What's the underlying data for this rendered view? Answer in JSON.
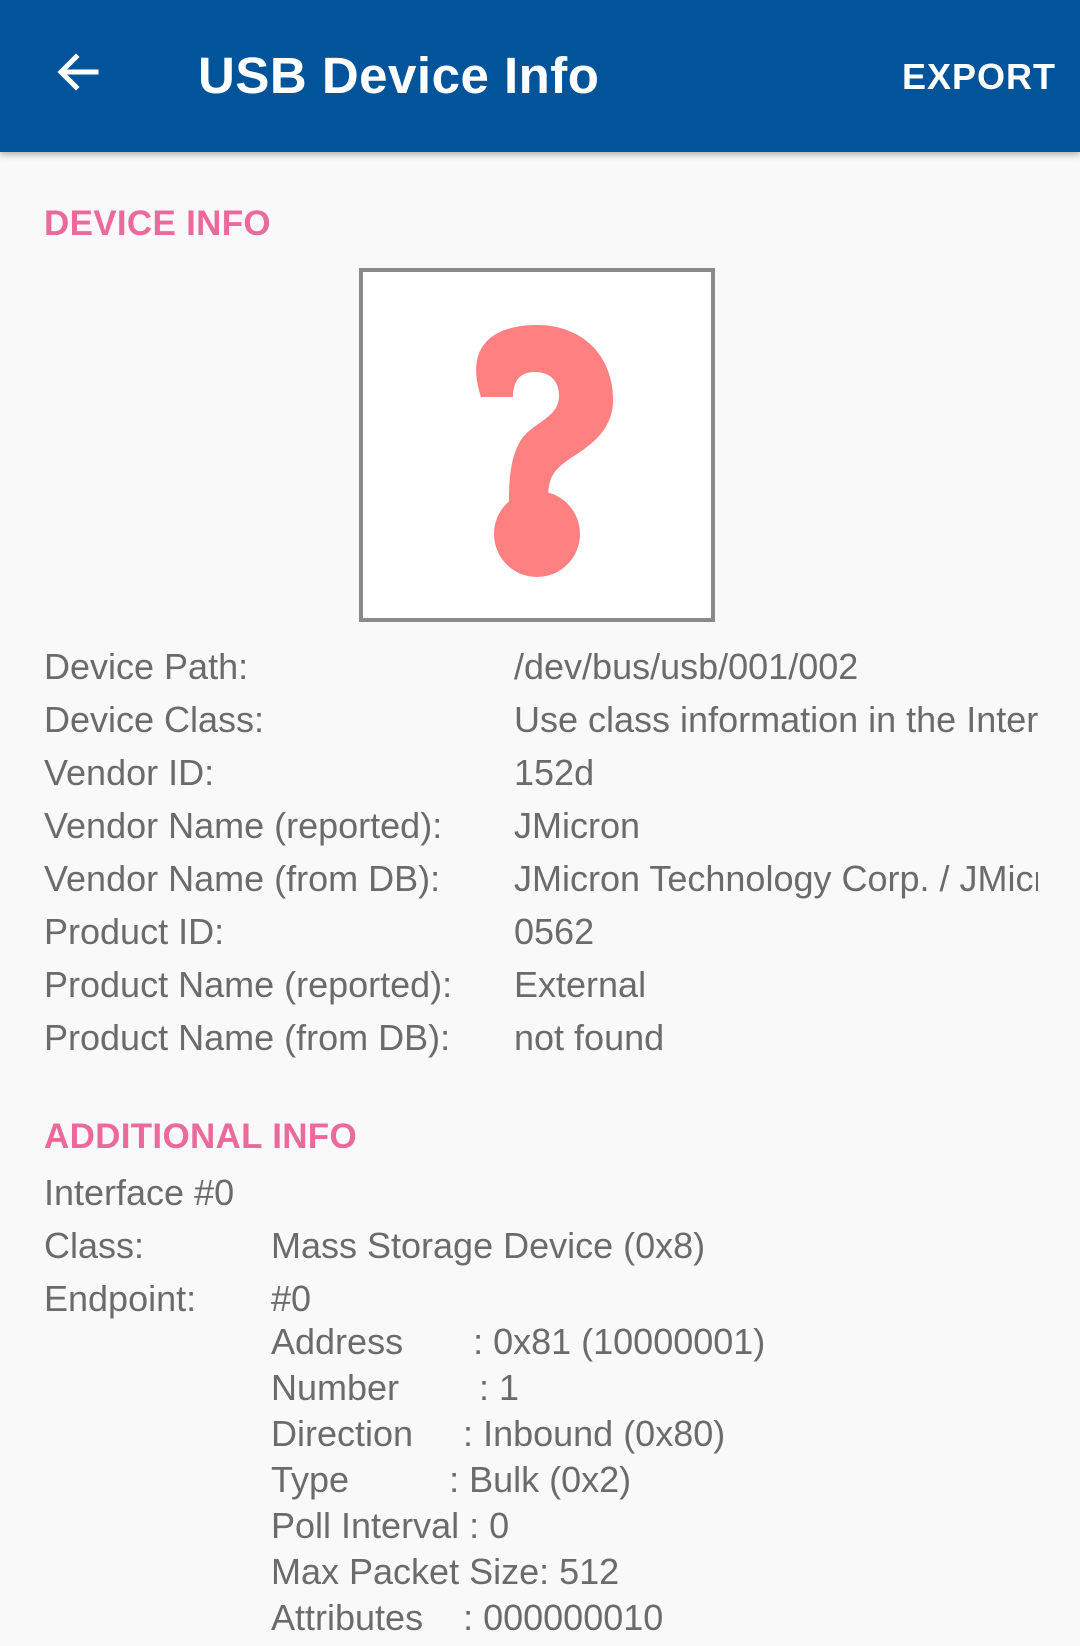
{
  "app_bar": {
    "title": "USB Device Info",
    "export_label": "EXPORT",
    "back_icon": "arrow-left-icon"
  },
  "colors": {
    "app_bar": "#02549a",
    "section_header": "#ea6b9b",
    "text": "#6b6b6b",
    "background": "#f9f9f9",
    "unknown_device_icon": "#ff8080"
  },
  "device_info": {
    "header": "DEVICE INFO",
    "image_icon": "question-mark-icon",
    "rows": [
      {
        "label": "Device Path:",
        "value": "/dev/bus/usb/001/002"
      },
      {
        "label": "Device Class:",
        "value": "Use class information in the Interface Descriptors"
      },
      {
        "label": "Vendor ID:",
        "value": "152d"
      },
      {
        "label": "Vendor Name (reported):",
        "value": "JMicron"
      },
      {
        "label": "Vendor Name (from DB):",
        "value": "JMicron Technology Corp. / JMicron USA Technology Corp."
      },
      {
        "label": "Product ID:",
        "value": "0562"
      },
      {
        "label": "Product Name (reported):",
        "value": "External"
      },
      {
        "label": "Product Name (from DB):",
        "value": "not found"
      }
    ]
  },
  "additional_info": {
    "header": "ADDITIONAL INFO",
    "interface_title": "Interface #0",
    "class_label": "Class:",
    "class_value": "Mass Storage Device (0x8)",
    "endpoint_label": "Endpoint:",
    "endpoint_value": "#0",
    "endpoint_details": [
      "Address       : 0x81 (10000001)",
      "Number        : 1",
      "Direction     : Inbound (0x80)",
      "Type          : Bulk (0x2)",
      "Poll Interval : 0",
      "Max Packet Size: 512",
      "Attributes    : 000000010"
    ]
  }
}
